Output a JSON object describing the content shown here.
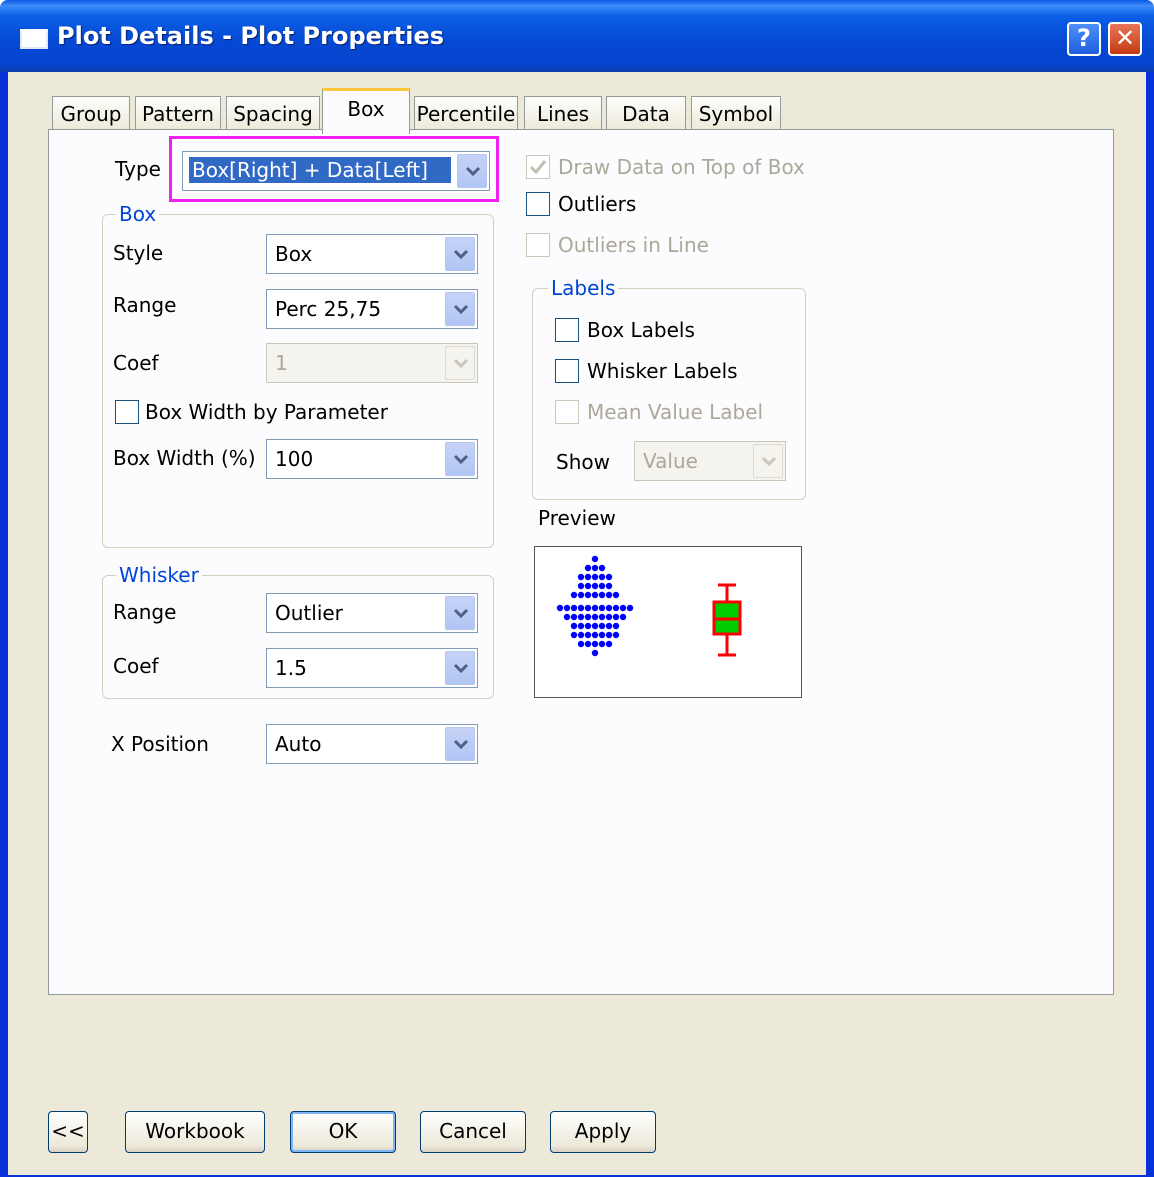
{
  "window": {
    "title": "Plot Details - Plot Properties",
    "help": "?",
    "close": "✕"
  },
  "tabs": [
    "Group",
    "Pattern",
    "Spacing",
    "Box",
    "Percentile",
    "Lines",
    "Data",
    "Symbol"
  ],
  "active_tab": "Box",
  "type_label": "Type",
  "type_value": "Box[Right] + Data[Left]",
  "box_group": {
    "legend": "Box",
    "style_label": "Style",
    "style_value": "Box",
    "range_label": "Range",
    "range_value": "Perc 25,75",
    "coef_label": "Coef",
    "coef_value": "1",
    "width_by_param": "Box Width by Parameter",
    "width_label": "Box Width (%)",
    "width_value": "100"
  },
  "whisker_group": {
    "legend": "Whisker",
    "range_label": "Range",
    "range_value": "Outlier",
    "coef_label": "Coef",
    "coef_value": "1.5"
  },
  "x_position_label": "X Position",
  "x_position_value": "Auto",
  "right": {
    "draw_on_top": "Draw Data on Top of Box",
    "outliers": "Outliers",
    "outliers_in_line": "Outliers in Line"
  },
  "labels_group": {
    "legend": "Labels",
    "box_labels": "Box Labels",
    "whisker_labels": "Whisker Labels",
    "mean_value_label": "Mean Value Label",
    "show_label": "Show",
    "show_value": "Value"
  },
  "preview_label": "Preview",
  "buttons": {
    "collapse": "<<",
    "workbook": "Workbook",
    "ok": "OK",
    "cancel": "Cancel",
    "apply": "Apply"
  },
  "colors": {
    "highlight": "#f020f0",
    "dots": "#0000ff",
    "box_stroke": "#ff0000",
    "box_fill": "#00cc00"
  }
}
